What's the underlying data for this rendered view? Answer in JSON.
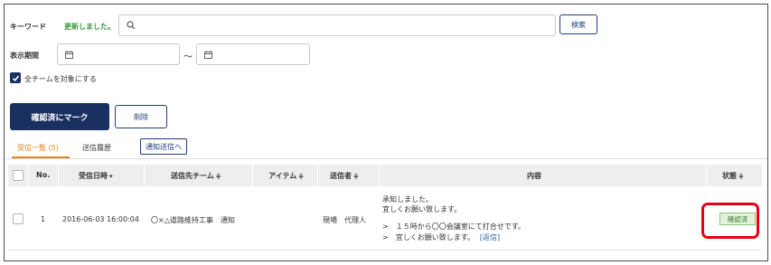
{
  "search": {
    "keyword_label": "キーワード",
    "updated_text": "更新しました。",
    "keyword_value": "",
    "search_button": "検索"
  },
  "period": {
    "label": "表示期間",
    "from_value": "",
    "separator": "〜",
    "to_value": ""
  },
  "all_teams": {
    "checked": true,
    "label": "全チームを対象にする"
  },
  "actions": {
    "mark_confirmed": "確認済にマーク",
    "delete": "削除"
  },
  "tabs": {
    "inbox": "受信一覧 (5)",
    "sent": "送信履歴",
    "notify_send": "通知送信へ"
  },
  "table": {
    "headers": {
      "no": "No.",
      "received": "受信日時",
      "team": "送信先チーム",
      "item": "アイテム",
      "sender": "送信者",
      "content": "内容",
      "status": "状態"
    },
    "sort_icons": {
      "received": "▾",
      "team": "≑",
      "item": "≑",
      "sender": "≑",
      "status": "≑"
    },
    "rows": [
      {
        "no": "1",
        "received": "2016-06-03 16:00:04",
        "team": "〇×△道路維持工事　通知",
        "item": "",
        "sender": "現場　代理人",
        "content_line1": "承知しました。",
        "content_line2": "宜しくお願い致します。",
        "quote_line1": ">　１５時から〇〇会議室にて打合せです。",
        "quote_line2": ">　宜しくお願い致します。",
        "reply_link": "[返信]",
        "status": "確認済"
      }
    ]
  },
  "colors": {
    "primary": "#1a3060",
    "tab_active": "#e8831a",
    "updated_green": "#3a9a3a",
    "status_green_bg": "#e4f2dc",
    "highlight_red": "#e60012"
  },
  "icons": {
    "search": "search-icon",
    "calendar": "calendar-icon",
    "check": "check-icon"
  }
}
